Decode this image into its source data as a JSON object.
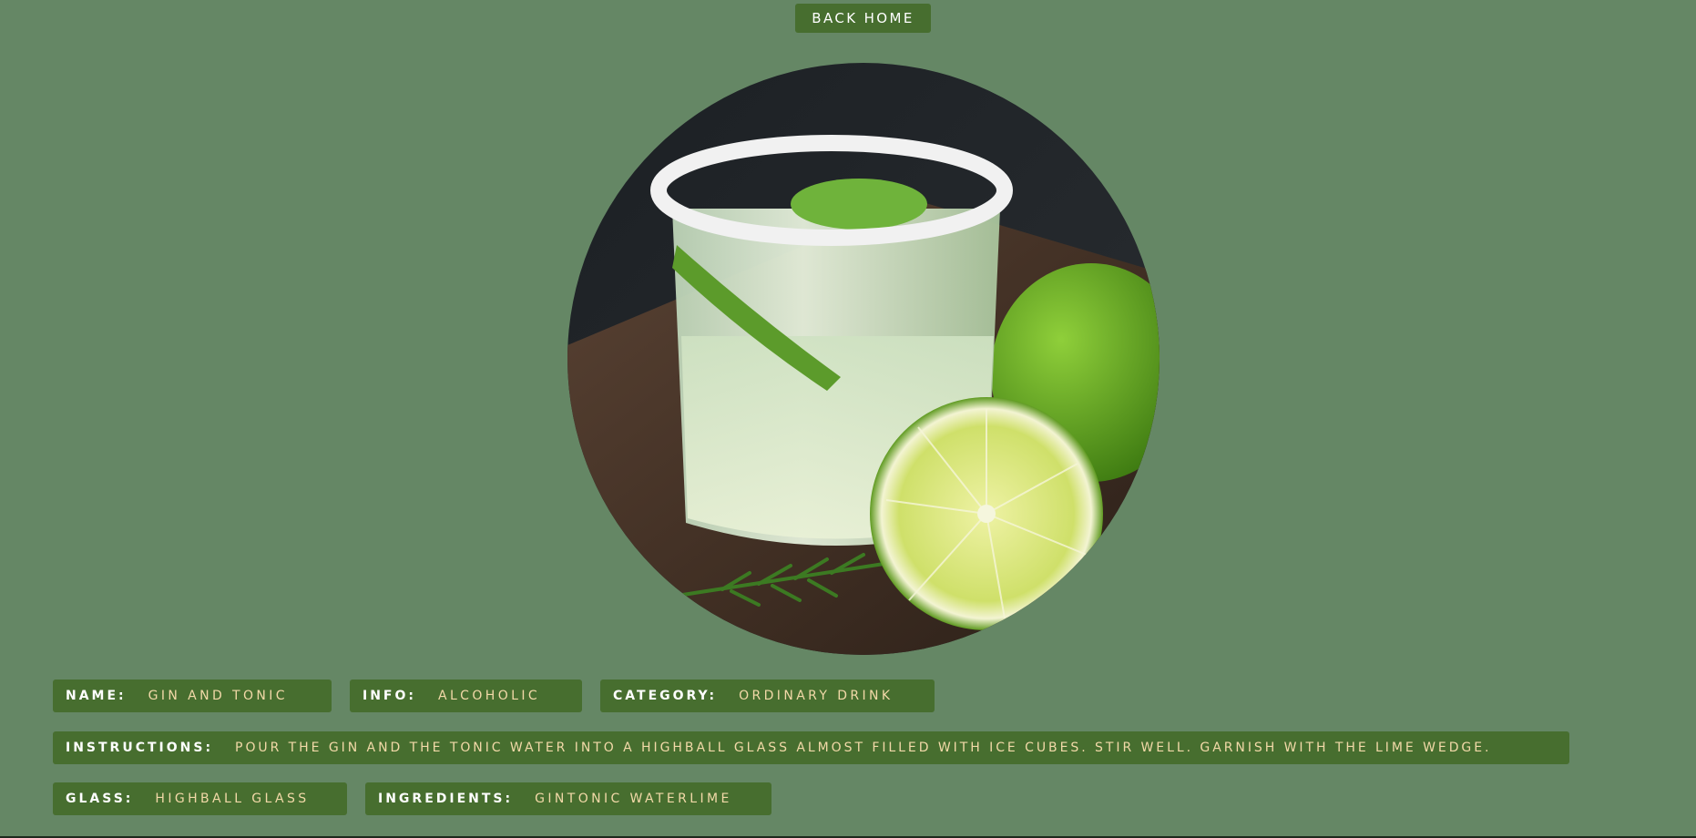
{
  "nav": {
    "back_label": "Back Home"
  },
  "drink_image": {
    "description_icon": "cocktail-photo"
  },
  "details": {
    "name": {
      "label": "Name:",
      "value": "Gin And Tonic"
    },
    "info": {
      "label": "Info:",
      "value": "Alcoholic"
    },
    "category": {
      "label": "Category:",
      "value": "Ordinary Drink"
    },
    "instructions": {
      "label": "Instructions:",
      "value": "Pour the gin and the tonic water into a highball glass almost filled with ice cubes. Stir well. Garnish with the lime wedge."
    },
    "glass": {
      "label": "Glass:",
      "value": "Highball glass"
    },
    "ingredients": {
      "label": "Ingredients:",
      "value": "GinTonic waterLime"
    }
  },
  "colors": {
    "background": "#658765",
    "chip": "#476e2f",
    "label_text": "#ffffff",
    "value_text": "#f2d9a8"
  }
}
